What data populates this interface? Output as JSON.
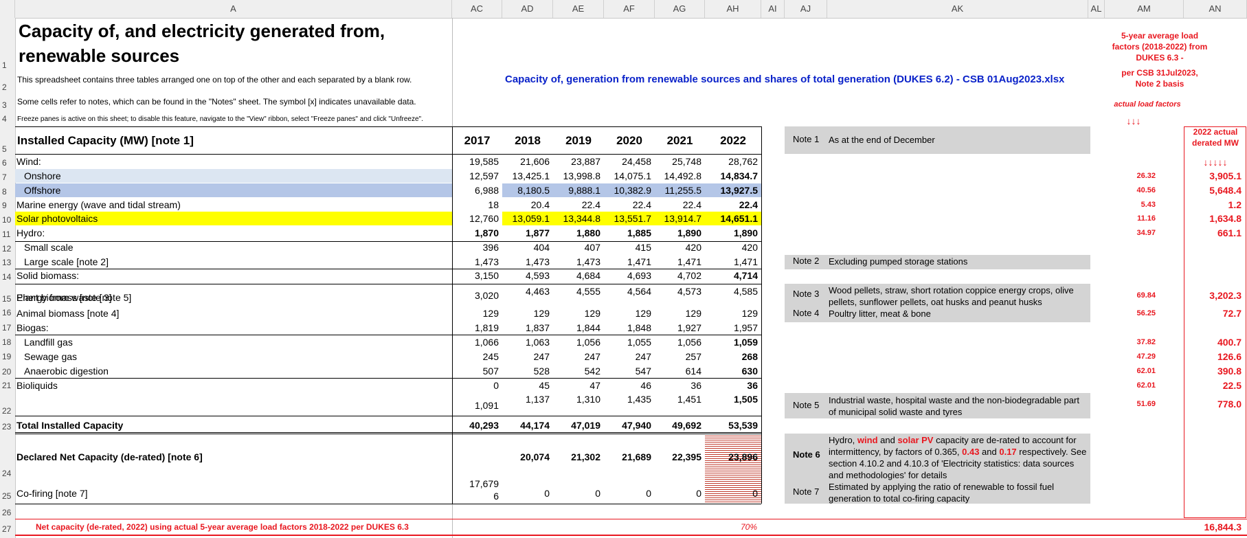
{
  "columns": [
    "A",
    "AC",
    "AD",
    "AE",
    "AF",
    "AG",
    "AH",
    "AI",
    "AJ",
    "AK",
    "AL",
    "AM",
    "AN"
  ],
  "rows": [
    "1",
    "2",
    "3",
    "4",
    "5",
    "6",
    "7",
    "8",
    "9",
    "10",
    "11",
    "12",
    "13",
    "14",
    "15",
    "16",
    "17",
    "18",
    "19",
    "20",
    "21",
    "22",
    "23",
    "24",
    "25",
    "26",
    "27"
  ],
  "title_line1": "Capacity of, and electricity generated from,",
  "title_line2": "renewable sources",
  "intro1": "This spreadsheet contains three tables arranged one on top of the other and each separated by a blank row.",
  "intro2": "Some cells refer to notes, which can be found in the \"Notes\" sheet. The symbol [x] indicates unavailable data.",
  "intro3": "Freeze panes is active on this sheet; to disable this feature, navigate to the \"View\" ribbon, select \"Freeze panes\" and click \"Unfreeze\".",
  "source_title": "Capacity of, generation from renewable sources and shares of total generation (DUKES 6.2) - CSB 01Aug2023.xlsx",
  "am_header1": "5-year average load factors (2018-2022) from DUKES 6.3 -",
  "am_header2": "per CSB 31Jul2023, Note 2 basis",
  "am_header3": "actual load factors",
  "am_arrows": "↓↓↓",
  "an_header": "2022 actual derated MW",
  "an_arrows": "↓↓↓↓↓",
  "table_header": "Installed Capacity (MW) [note 1]",
  "years": [
    "2017",
    "2018",
    "2019",
    "2020",
    "2021",
    "2022"
  ],
  "table": [
    {
      "label": "Wind:",
      "vals": [
        "19,585",
        "21,606",
        "23,887",
        "24,458",
        "25,748",
        "28,762"
      ],
      "am": "",
      "an": ""
    },
    {
      "label": "Onshore",
      "vals": [
        "12,597",
        "13,425.1",
        "13,998.8",
        "14,075.1",
        "14,492.8",
        "14,834.7"
      ],
      "am": "26.32",
      "an": "3,905.1"
    },
    {
      "label": "Offshore",
      "vals": [
        "6,988",
        "8,180.5",
        "9,888.1",
        "10,382.9",
        "11,255.5",
        "13,927.5"
      ],
      "am": "40.56",
      "an": "5,648.4"
    },
    {
      "label": "Marine energy (wave and tidal stream)",
      "vals": [
        "18",
        "20.4",
        "22.4",
        "22.4",
        "22.4",
        "22.4"
      ],
      "am": "5.43",
      "an": "1.2"
    },
    {
      "label": "Solar photovoltaics",
      "vals": [
        "12,760",
        "13,059.1",
        "13,344.8",
        "13,551.7",
        "13,914.7",
        "14,651.1"
      ],
      "am": "11.16",
      "an": "1,634.8"
    },
    {
      "label": "Hydro:",
      "vals": [
        "1,870",
        "1,877",
        "1,880",
        "1,885",
        "1,890",
        "1,890"
      ],
      "am": "34.97",
      "an": "661.1"
    },
    {
      "label": "Small scale",
      "vals": [
        "396",
        "404",
        "407",
        "415",
        "420",
        "420"
      ],
      "am": "",
      "an": ""
    },
    {
      "label": "Large scale [note 2]",
      "vals": [
        "1,473",
        "1,473",
        "1,473",
        "1,471",
        "1,471",
        "1,471"
      ],
      "am": "",
      "an": ""
    },
    {
      "label": "Solid biomass:",
      "vals": [
        "3,150",
        "4,593",
        "4,684",
        "4,693",
        "4,702",
        "4,714"
      ],
      "am": "",
      "an": ""
    },
    {
      "label": "Plant biomass [note 3]",
      "vals": [
        "3,020",
        "4,463",
        "4,555",
        "4,564",
        "4,573",
        "4,585"
      ],
      "am": "69.84",
      "an": "3,202.3"
    },
    {
      "label": "Animal biomass [note 4]",
      "vals": [
        "129",
        "129",
        "129",
        "129",
        "129",
        "129"
      ],
      "am": "56.25",
      "an": "72.7"
    },
    {
      "label": "Biogas:",
      "vals": [
        "1,819",
        "1,837",
        "1,844",
        "1,848",
        "1,927",
        "1,957"
      ],
      "am": "",
      "an": ""
    },
    {
      "label": "Landfill gas",
      "vals": [
        "1,066",
        "1,063",
        "1,056",
        "1,055",
        "1,056",
        "1,059"
      ],
      "am": "37.82",
      "an": "400.7"
    },
    {
      "label": "Sewage gas",
      "vals": [
        "245",
        "247",
        "247",
        "247",
        "257",
        "268"
      ],
      "am": "47.29",
      "an": "126.6"
    },
    {
      "label": "Anaerobic digestion",
      "vals": [
        "507",
        "528",
        "542",
        "547",
        "614",
        "630"
      ],
      "am": "62.01",
      "an": "390.8"
    },
    {
      "label": "Bioliquids",
      "vals": [
        "0",
        "45",
        "47",
        "46",
        "36",
        "36"
      ],
      "am": "62.01",
      "an": "22.5"
    },
    {
      "label": "Energy from waste [note 5]",
      "vals": [
        "1,091",
        "1,137",
        "1,310",
        "1,435",
        "1,451",
        "1,505"
      ],
      "am": "51.69",
      "an": "778.0"
    },
    {
      "label": "Total Installed Capacity",
      "vals": [
        "40,293",
        "44,174",
        "47,019",
        "47,940",
        "49,692",
        "53,539"
      ],
      "am": "",
      "an": ""
    },
    {
      "label": "Declared Net Capacity (de-rated) [note 6]",
      "vals": [
        "17,679",
        "20,074",
        "21,302",
        "21,689",
        "22,395",
        "23,896"
      ],
      "am": "",
      "an": ""
    },
    {
      "label": "Co-firing [note 7]",
      "vals": [
        "6",
        "0",
        "0",
        "0",
        "0",
        "0"
      ],
      "am": "",
      "an": ""
    }
  ],
  "notes": [
    {
      "label": "Note 1",
      "text": "As at the end of December"
    },
    {
      "label": "Note 2",
      "text": "Excluding pumped storage stations"
    },
    {
      "label": "Note 3",
      "text": "Wood pellets, straw, short rotation coppice energy crops, olive pellets, sunflower pellets, oat husks and peanut husks"
    },
    {
      "label": "Note 4",
      "text": "Poultry litter, meat & bone"
    },
    {
      "label": "Note 5",
      "text": "Industrial waste, hospital waste and the non-biodegradable part of municipal solid waste and tyres"
    },
    {
      "label": "Note 6",
      "text_a": "Hydro, ",
      "text_b": "wind",
      "text_c": " and ",
      "text_d": "solar PV",
      "text_e": " capacity are de-rated to account for intermittency, by factors of 0.365, ",
      "text_f": "0.43",
      "text_g": " and ",
      "text_h": "0.17",
      "text_i": " respectively. See section 4.10.2 and 4.10.3 of 'Electricity statistics: data sources and methodologies' for details"
    },
    {
      "label": "Note 7",
      "text": "Estimated by applying the ratio of renewable to fossil fuel generation to total co-firing capacity"
    }
  ],
  "net_label": "Net capacity (de-rated, 2022) using actual 5-year average load factors 2018-2022 per DUKES 6.3",
  "net_pct": "70%",
  "net_total": "16,844.3",
  "colors": {
    "yellow": "#ffff00",
    "blue": "#b4c6e7",
    "lightblue": "#dce6f2",
    "gray": "#d4d4d4",
    "red": "#e8171f",
    "navy": "#0a22c9"
  }
}
